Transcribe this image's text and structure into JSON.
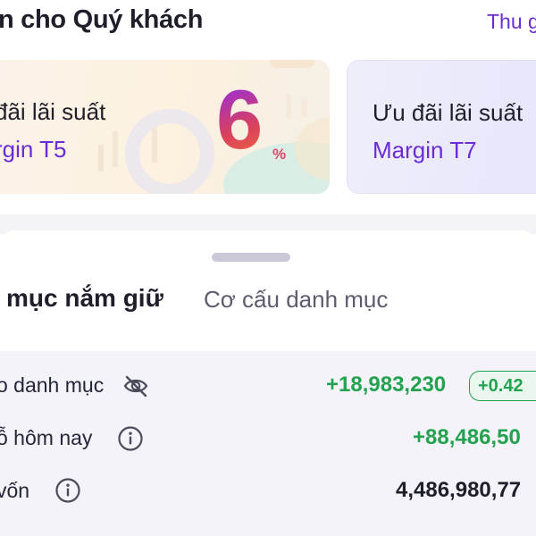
{
  "header": {
    "title": "n cho Quý khách",
    "collapse_label": "Thu g"
  },
  "promo_cards": [
    {
      "title": "đãi lãi suất",
      "subtitle": "rgin T5",
      "highlight_value": "6",
      "highlight_unit": "%"
    },
    {
      "title": "Ưu đãi lãi suất",
      "subtitle": "Margin T7"
    }
  ],
  "portfolio": {
    "tabs": [
      {
        "label": "mục nắm giữ",
        "active": true
      },
      {
        "label": "Cơ cấu danh mục",
        "active": false
      }
    ],
    "summary": [
      {
        "label": "o danh mục",
        "icon": "eye-slash-icon",
        "value": "+18,983,230",
        "badge": "+0.42",
        "tone": "positive"
      },
      {
        "label": "ỗ hôm nay",
        "icon": "info-icon",
        "value": "+88,486,50",
        "tone": "positive"
      },
      {
        "label": "vốn",
        "icon": "info-icon",
        "value": "4,486,980,77",
        "tone": "neutral"
      }
    ]
  },
  "colors": {
    "accent": "#6b2cd6",
    "positive": "#23a24f",
    "text": "#1f1f2b"
  }
}
